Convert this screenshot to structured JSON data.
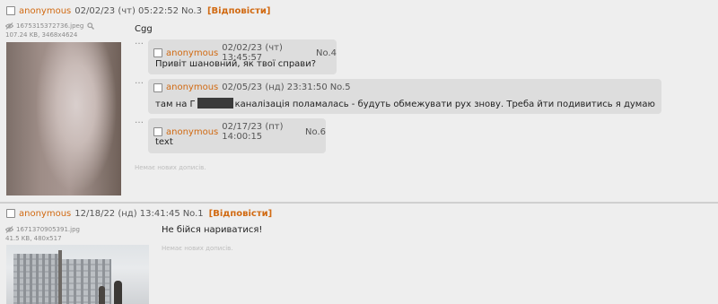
{
  "threads": [
    {
      "post": {
        "name": "anonymous",
        "datetime": "02/02/23 (чт) 05:22:52",
        "number": "No.3",
        "reply_label": "[Відповісти]",
        "file": {
          "name": "1675315372736.jpeg",
          "details": "107.24 KB, 3468x4624"
        },
        "text": "Cgg",
        "replies": [
          {
            "name": "anonymous",
            "datetime": "02/02/23 (чт) 13:45:57",
            "number": "No.4",
            "text": "Привіт шановний, як твої справи?"
          },
          {
            "name": "anonymous",
            "datetime": "02/05/23 (нд) 23:31:50",
            "number": "No.5",
            "text_before": "там на Г",
            "text_after": "каналізація поламалась - будуть обмежувати рух знову. Треба йти подивитись я думаю"
          },
          {
            "name": "anonymous",
            "datetime": "02/17/23 (пт) 14:00:15",
            "number": "No.6",
            "text": "text"
          }
        ],
        "no_new_posts": "Немає нових дописів."
      }
    },
    {
      "post": {
        "name": "anonymous",
        "datetime": "12/18/22 (нд) 13:41:45",
        "number": "No.1",
        "reply_label": "[Відповісти]",
        "file": {
          "name": "1671370905391.jpg",
          "details": "41.5 KB, 480x517"
        },
        "text": "Не бійся нариватися!",
        "no_new_posts": "Немає нових дописів."
      }
    }
  ],
  "colors": {
    "accent": "#d16a12",
    "background": "#eeeeee",
    "reply_bg": "#dddddd"
  }
}
